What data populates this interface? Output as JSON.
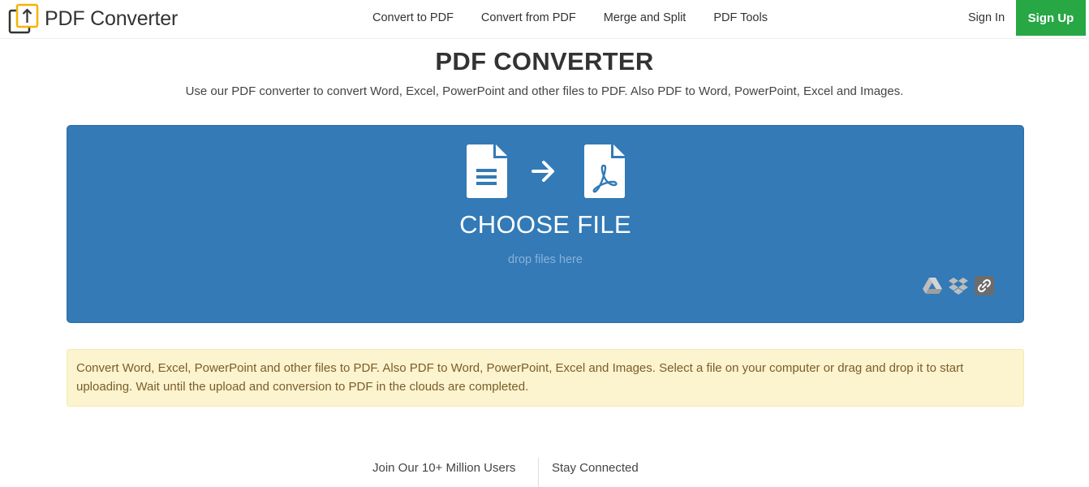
{
  "header": {
    "logo_text": "PDF Converter",
    "nav": [
      "Convert to PDF",
      "Convert from PDF",
      "Merge and Split",
      "PDF Tools"
    ],
    "sign_in": "Sign In",
    "sign_up": "Sign Up"
  },
  "main": {
    "title": "PDF CONVERTER",
    "subtitle": "Use our PDF converter to convert Word, Excel, PowerPoint and other files to PDF. Also PDF to Word, PowerPoint, Excel and Images.",
    "dropzone": {
      "choose_file": "CHOOSE FILE",
      "drop_hint": "drop files here",
      "icons": [
        "document-icon",
        "arrow-right-icon",
        "pdf-file-icon"
      ],
      "cloud_sources": [
        "google-drive-icon",
        "dropbox-icon",
        "link-icon"
      ]
    },
    "info": "Convert Word, Excel, PowerPoint and other files to PDF. Also PDF to Word, PowerPoint, Excel and Images. Select a file on your computer or drag and drop it to start uploading. Wait until the upload and conversion to PDF in the clouds are completed."
  },
  "footer": {
    "left": "Join Our 10+ Million Users",
    "right": "Stay Connected"
  },
  "colors": {
    "brand_blue": "#337ab7",
    "signup_green": "#28a745",
    "logo_yellow": "#f5b400",
    "info_bg": "#fcf3cf",
    "info_text": "#7a5e2a"
  }
}
